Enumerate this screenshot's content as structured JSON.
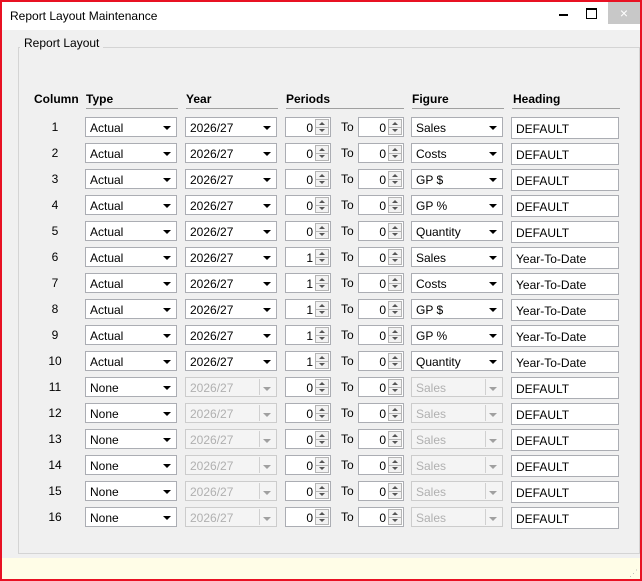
{
  "window": {
    "title": "Report Layout Maintenance",
    "close_glyph": "×"
  },
  "group_label": "Report Layout",
  "headers": {
    "column": "Column",
    "type": "Type",
    "year": "Year",
    "periods": "Periods",
    "figure": "Figure",
    "heading": "Heading"
  },
  "to_label": "To",
  "rows": [
    {
      "num": "1",
      "type": "Actual",
      "year": "2026/27",
      "from": "0",
      "to": "0",
      "figure": "Sales",
      "heading": "DEFAULT",
      "enabled": true
    },
    {
      "num": "2",
      "type": "Actual",
      "year": "2026/27",
      "from": "0",
      "to": "0",
      "figure": "Costs",
      "heading": "DEFAULT",
      "enabled": true
    },
    {
      "num": "3",
      "type": "Actual",
      "year": "2026/27",
      "from": "0",
      "to": "0",
      "figure": "GP $",
      "heading": "DEFAULT",
      "enabled": true
    },
    {
      "num": "4",
      "type": "Actual",
      "year": "2026/27",
      "from": "0",
      "to": "0",
      "figure": "GP %",
      "heading": "DEFAULT",
      "enabled": true
    },
    {
      "num": "5",
      "type": "Actual",
      "year": "2026/27",
      "from": "0",
      "to": "0",
      "figure": "Quantity",
      "heading": "DEFAULT",
      "enabled": true
    },
    {
      "num": "6",
      "type": "Actual",
      "year": "2026/27",
      "from": "1",
      "to": "0",
      "figure": "Sales",
      "heading": "Year-To-Date",
      "enabled": true
    },
    {
      "num": "7",
      "type": "Actual",
      "year": "2026/27",
      "from": "1",
      "to": "0",
      "figure": "Costs",
      "heading": "Year-To-Date",
      "enabled": true
    },
    {
      "num": "8",
      "type": "Actual",
      "year": "2026/27",
      "from": "1",
      "to": "0",
      "figure": "GP $",
      "heading": "Year-To-Date",
      "enabled": true
    },
    {
      "num": "9",
      "type": "Actual",
      "year": "2026/27",
      "from": "1",
      "to": "0",
      "figure": "GP %",
      "heading": "Year-To-Date",
      "enabled": true
    },
    {
      "num": "10",
      "type": "Actual",
      "year": "2026/27",
      "from": "1",
      "to": "0",
      "figure": "Quantity",
      "heading": "Year-To-Date",
      "enabled": true
    },
    {
      "num": "11",
      "type": "None",
      "year": "2026/27",
      "from": "0",
      "to": "0",
      "figure": "Sales",
      "heading": "DEFAULT",
      "enabled": false
    },
    {
      "num": "12",
      "type": "None",
      "year": "2026/27",
      "from": "0",
      "to": "0",
      "figure": "Sales",
      "heading": "DEFAULT",
      "enabled": false
    },
    {
      "num": "13",
      "type": "None",
      "year": "2026/27",
      "from": "0",
      "to": "0",
      "figure": "Sales",
      "heading": "DEFAULT",
      "enabled": false
    },
    {
      "num": "14",
      "type": "None",
      "year": "2026/27",
      "from": "0",
      "to": "0",
      "figure": "Sales",
      "heading": "DEFAULT",
      "enabled": false
    },
    {
      "num": "15",
      "type": "None",
      "year": "2026/27",
      "from": "0",
      "to": "0",
      "figure": "Sales",
      "heading": "DEFAULT",
      "enabled": false
    },
    {
      "num": "16",
      "type": "None",
      "year": "2026/27",
      "from": "0",
      "to": "0",
      "figure": "Sales",
      "heading": "DEFAULT",
      "enabled": false
    }
  ],
  "colors": {
    "window_border": "#e81123",
    "statusbar": "#fffde7",
    "disabled_text": "#b0b0b0"
  }
}
